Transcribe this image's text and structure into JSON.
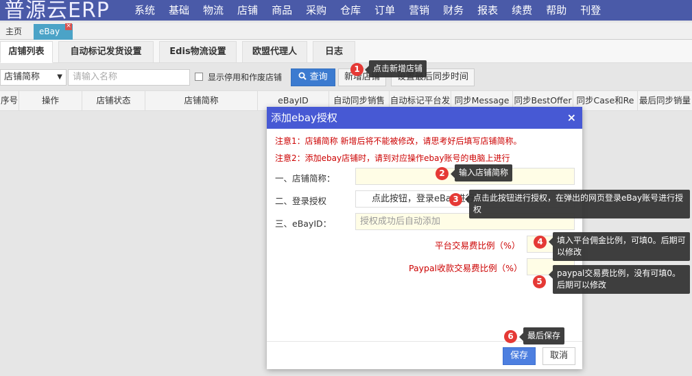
{
  "app": {
    "logo": "普源云ERP"
  },
  "menu": [
    "系统",
    "基础",
    "物流",
    "店铺",
    "商品",
    "采购",
    "仓库",
    "订单",
    "营销",
    "财务",
    "报表",
    "续费",
    "帮助",
    "刊登"
  ],
  "page_tabs": {
    "home": "主页",
    "ebay": "eBay",
    "close": "×"
  },
  "sub_tabs": [
    "店铺列表",
    "自动标记发货设置",
    "Edis物流设置",
    "欧盟代理人",
    "日志"
  ],
  "filters": {
    "shop_select": "店铺简称",
    "caret": "▼",
    "search_placeholder": "请输入名称",
    "show_disabled_label": "显示停用和作废店铺",
    "query_button": "查询",
    "add_shop_button": "新增店铺",
    "set_sync_time_button": "设置最后同步时间"
  },
  "grid_columns": [
    "序号",
    "操作",
    "店铺状态",
    "店铺简称",
    "eBayID",
    "自动同步销售",
    "自动标记平台发",
    "同步Message",
    "同步BestOffer",
    "同步Case和Re",
    "最后同步销量"
  ],
  "modal": {
    "title": "添加ebay授权",
    "close": "×",
    "note1": "注意1：店铺简称 新增后将不能被修改，请思考好后填写店铺简称。",
    "note2": "注意2：添加ebay店铺时，请到对应操作ebay账号的电脑上进行",
    "shop_name_label": "一、店铺简称：",
    "authorize_label": "二、登录授权",
    "authorize_button": "点此按钮，登录eBay进行授权",
    "ebayid_label": "三、eBayID：",
    "ebayid_placeholder": "授权成功后自动添加",
    "platform_fee_label": "平台交易费比例（%）",
    "paypal_fee_label": "Paypal收款交易费比例（%）",
    "save_button": "保存",
    "cancel_button": "取消"
  },
  "callouts": [
    {
      "num": "1",
      "text": "点击新增店铺"
    },
    {
      "num": "2",
      "text": "输入店铺简称"
    },
    {
      "num": "3",
      "text": "点击此按钮进行授权，在弹出的网页登录eBay账号进行授权"
    },
    {
      "num": "4",
      "text": "填入平台佣金比例，可填0。后期可以修改"
    },
    {
      "num": "5",
      "text": "paypal交易费比例，没有可填0。后期可以修改"
    },
    {
      "num": "6",
      "text": "最后保存"
    }
  ],
  "colors": {
    "nav": "#4a5aa8",
    "modal_header": "#4759d4",
    "primary_button": "#4d7fe0",
    "badge": "#e53935",
    "note_red": "#cc0000"
  }
}
